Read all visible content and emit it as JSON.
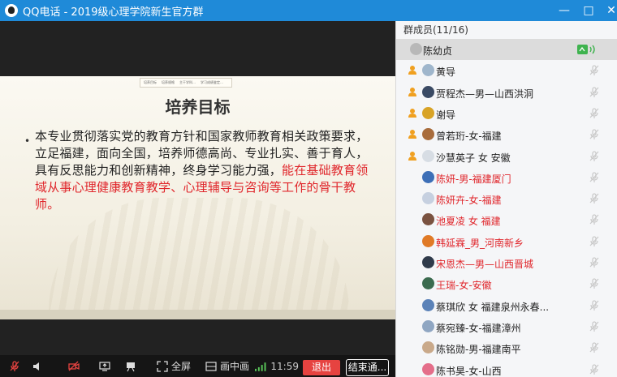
{
  "window": {
    "title": "QQ电话 - 2019级心理学院新生官方群",
    "minimize_label": "—",
    "maximize_label": "□",
    "close_label": "✕"
  },
  "slide": {
    "nav_items": [
      "培养目标",
      "培养规格",
      "主干学科…",
      "学习成绩鉴定…"
    ],
    "heading": "培养目标",
    "bullet": "•",
    "body_black": "本专业贯彻落实党的教育方针和国家教师教育相关政策要求，立足福建，面向全国，培养师德高尚、专业扎实、善于育人，具有反思能力和创新精神，终身学习能力强，",
    "body_red": "能在基础教育领域从事心理健康教育教学、心理辅导与咨询等工作的骨干教师。"
  },
  "toolbar": {
    "fullscreen_label": "全屏",
    "pip_label": "画中画",
    "time": "11:59",
    "exit_label": "退出",
    "end_label": "结束通..."
  },
  "panel": {
    "header": "群成员(11/16)",
    "members": [
      {
        "name": "陈幼贞",
        "selected": true,
        "admin": false,
        "red": false,
        "avatar_color": "#b8b8b8"
      },
      {
        "name": "黄导",
        "selected": false,
        "admin": true,
        "red": false,
        "avatar_color": "#9fb6cc"
      },
      {
        "name": "贾程杰—男—山西洪洞",
        "selected": false,
        "admin": true,
        "red": false,
        "avatar_color": "#3a4a64"
      },
      {
        "name": "谢导",
        "selected": false,
        "admin": true,
        "red": false,
        "avatar_color": "#d8a326"
      },
      {
        "name": "曾若珩-女-福建",
        "selected": false,
        "admin": true,
        "red": false,
        "avatar_color": "#a86c3c"
      },
      {
        "name": "沙慧英子 女 安徽",
        "selected": false,
        "admin": true,
        "red": false,
        "avatar_color": "#d7dde4"
      },
      {
        "name": "陈妍-男-福建厦门",
        "selected": false,
        "admin": false,
        "red": true,
        "avatar_color": "#3d6fb7"
      },
      {
        "name": "陈妍卉-女-福建",
        "selected": false,
        "admin": false,
        "red": true,
        "avatar_color": "#c6d0e0"
      },
      {
        "name": "池夏凌 女 福建",
        "selected": false,
        "admin": false,
        "red": true,
        "avatar_color": "#7a5240"
      },
      {
        "name": "韩延霖_男_河南新乡",
        "selected": false,
        "admin": false,
        "red": true,
        "avatar_color": "#e07a26"
      },
      {
        "name": "宋恩杰—男—山西晋城",
        "selected": false,
        "admin": false,
        "red": true,
        "avatar_color": "#2f3a4a"
      },
      {
        "name": "王瑞-女-安徽",
        "selected": false,
        "admin": false,
        "red": true,
        "avatar_color": "#3b6b4f"
      },
      {
        "name": "蔡琪欣 女 福建泉州永春...",
        "selected": false,
        "admin": false,
        "red": false,
        "avatar_color": "#5b82b8"
      },
      {
        "name": "蔡宛臻-女-福建漳州",
        "selected": false,
        "admin": false,
        "red": false,
        "avatar_color": "#8fa6c2"
      },
      {
        "name": "陈铭勋-男-福建南平",
        "selected": false,
        "admin": false,
        "red": false,
        "avatar_color": "#c9a98a"
      },
      {
        "name": "陈书昊-女-山西",
        "selected": false,
        "admin": false,
        "red": false,
        "avatar_color": "#e46e8a"
      }
    ]
  }
}
